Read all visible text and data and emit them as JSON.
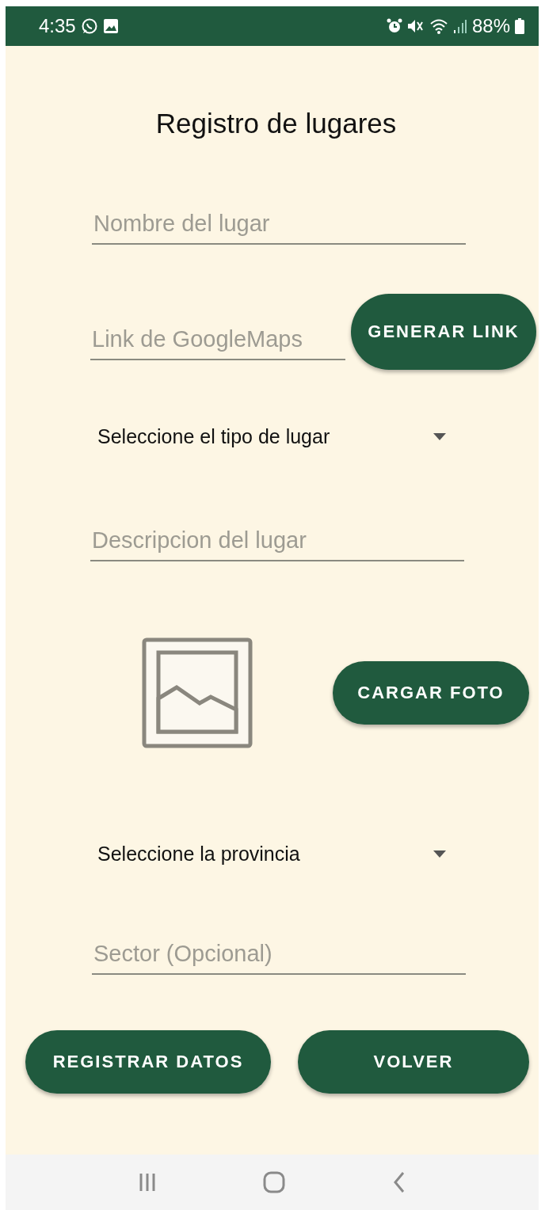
{
  "status_bar": {
    "time": "4:35",
    "battery": "88%"
  },
  "title": "Registro de lugares",
  "name_field": {
    "placeholder": "Nombre del lugar"
  },
  "link_field": {
    "placeholder": "Link de GoogleMaps"
  },
  "link_button": {
    "label": "GENERAR LINK"
  },
  "type_spinner": {
    "value": "Seleccione el tipo de lugar"
  },
  "description_field": {
    "placeholder": "Descripcion del lugar"
  },
  "photo_button": {
    "label": "CARGAR FOTO"
  },
  "province_spinner": {
    "value": "Seleccione la provincia"
  },
  "sector_field": {
    "placeholder": "Sector (Opcional)"
  },
  "buttons": [
    {
      "label": "REGISTRAR DATOS"
    },
    {
      "label": "VOLVER"
    }
  ]
}
